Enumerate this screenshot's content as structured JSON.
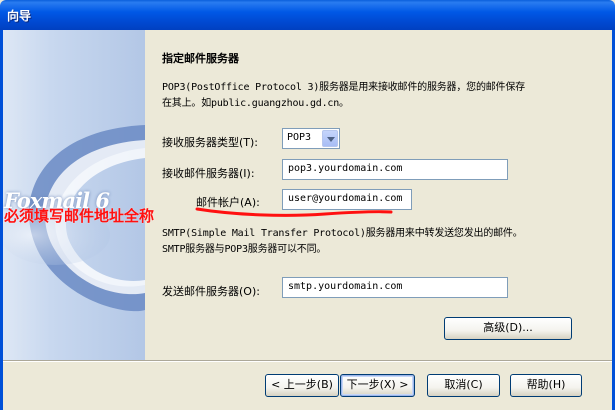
{
  "window": {
    "title": "向导"
  },
  "banner": {
    "logo": "Foxmail 6"
  },
  "page": {
    "heading": "指定邮件服务器",
    "pop3_desc_line1": "POP3(PostOffice Protocol 3)服务器是用来接收邮件的服务器，您的邮件保存",
    "pop3_desc_line2": "在其上。如public.guangzhou.gd.cn。",
    "server_type_label": "接收服务器类型",
    "server_type_key": "(T):",
    "server_type_value": "POP3",
    "incoming_label": "接收邮件服务器",
    "incoming_key": "(I):",
    "incoming_value": "pop3.yourdomain.com",
    "account_label": "邮件帐户",
    "account_key": "(A):",
    "account_value": "user@yourdomain.com",
    "smtp_desc_line1": "SMTP(Simple Mail Transfer Protocol)服务器用来中转发送您发出的邮件。",
    "smtp_desc_line2": "SMTP服务器与POP3服务器可以不同。",
    "outgoing_label": "发送邮件服务器",
    "outgoing_key": "(O):",
    "outgoing_value": "smtp.yourdomain.com",
    "advanced_button": "高级(D)..."
  },
  "buttons": {
    "back": "< 上一步(B)",
    "next": "下一步(X) >",
    "cancel": "取消(C)",
    "help": "帮助(H)"
  },
  "annotation": {
    "text": "必须填写邮件地址全称",
    "color": "#ff1010"
  }
}
